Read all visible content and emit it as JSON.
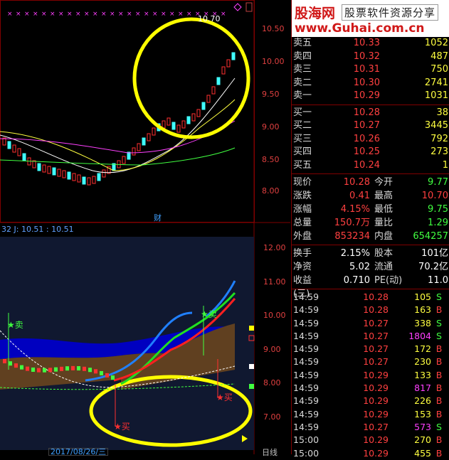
{
  "top_chart": {
    "price_axis": [
      "10.50",
      "10.00",
      "9.50",
      "9.00",
      "8.50",
      "8.00"
    ],
    "high_marker": "10.70",
    "label_cai": "财"
  },
  "bottom_chart": {
    "indicator_text": "32  J: 10.51 : 10.51",
    "price_axis": [
      "12.00",
      "11.00",
      "10.00",
      "9.00",
      "8.00",
      "7.00"
    ],
    "signals": {
      "sell": "卖",
      "buy": "买"
    },
    "date_label": "2017/08/26/三",
    "period_label": "日线"
  },
  "logo": {
    "site_name": "股海网",
    "tagline": "股票软件资源分享",
    "url": "www.Guhai.com.cn"
  },
  "order_book": {
    "sell": [
      {
        "label": "卖五",
        "price": "10.33",
        "vol": "1052"
      },
      {
        "label": "卖四",
        "price": "10.32",
        "vol": "487"
      },
      {
        "label": "卖三",
        "price": "10.31",
        "vol": "750"
      },
      {
        "label": "卖二",
        "price": "10.30",
        "vol": "2741"
      },
      {
        "label": "卖一",
        "price": "10.29",
        "vol": "1031"
      }
    ],
    "buy": [
      {
        "label": "买一",
        "price": "10.28",
        "vol": "38"
      },
      {
        "label": "买二",
        "price": "10.27",
        "vol": "3445"
      },
      {
        "label": "买三",
        "price": "10.26",
        "vol": "792"
      },
      {
        "label": "买四",
        "price": "10.25",
        "vol": "273"
      },
      {
        "label": "买五",
        "price": "10.24",
        "vol": "1"
      }
    ]
  },
  "stats": [
    {
      "k": "现价",
      "v": "10.28",
      "k2": "今开",
      "v2": "9.77"
    },
    {
      "k": "涨跌",
      "v": "0.41",
      "k2": "最高",
      "v2": "10.70"
    },
    {
      "k": "涨幅",
      "v": "4.15%",
      "k2": "最低",
      "v2": "9.75"
    },
    {
      "k": "总量",
      "v": "150.7万",
      "k2": "量比",
      "v2": "1.29"
    },
    {
      "k": "外盘",
      "v": "853234",
      "k2": "内盘",
      "v2": "654257"
    }
  ],
  "stats2": [
    {
      "k": "换手",
      "v": "2.15%",
      "k2": "股本",
      "v2": "101亿"
    },
    {
      "k": "净资",
      "v": "5.02",
      "k2": "流通",
      "v2": "70.2亿"
    },
    {
      "k": "收益(三)",
      "v": "0.710",
      "k2": "PE(动)",
      "v2": "11.0"
    }
  ],
  "ticks": [
    {
      "t": "14:59",
      "p": "10.28",
      "vol": "105",
      "bs": "S"
    },
    {
      "t": "14:59",
      "p": "10.28",
      "vol": "163",
      "bs": "B"
    },
    {
      "t": "14:59",
      "p": "10.27",
      "vol": "338",
      "bs": "S"
    },
    {
      "t": "14:59",
      "p": "10.27",
      "vol": "1804",
      "bs": "S"
    },
    {
      "t": "14:59",
      "p": "10.27",
      "vol": "172",
      "bs": "B"
    },
    {
      "t": "14:59",
      "p": "10.27",
      "vol": "230",
      "bs": "B"
    },
    {
      "t": "14:59",
      "p": "10.29",
      "vol": "133",
      "bs": "B"
    },
    {
      "t": "14:59",
      "p": "10.29",
      "vol": "817",
      "bs": "B"
    },
    {
      "t": "14:59",
      "p": "10.29",
      "vol": "226",
      "bs": "B"
    },
    {
      "t": "14:59",
      "p": "10.29",
      "vol": "153",
      "bs": "B"
    },
    {
      "t": "14:59",
      "p": "10.27",
      "vol": "573",
      "bs": "S"
    },
    {
      "t": "15:00",
      "p": "10.29",
      "vol": "270",
      "bs": "B"
    },
    {
      "t": "15:00",
      "p": "10.29",
      "vol": "455",
      "bs": "B"
    }
  ],
  "colors": {
    "up": "#ff3030",
    "down": "#40ffff",
    "green": "#40ff40",
    "yellow": "#ffff00"
  }
}
